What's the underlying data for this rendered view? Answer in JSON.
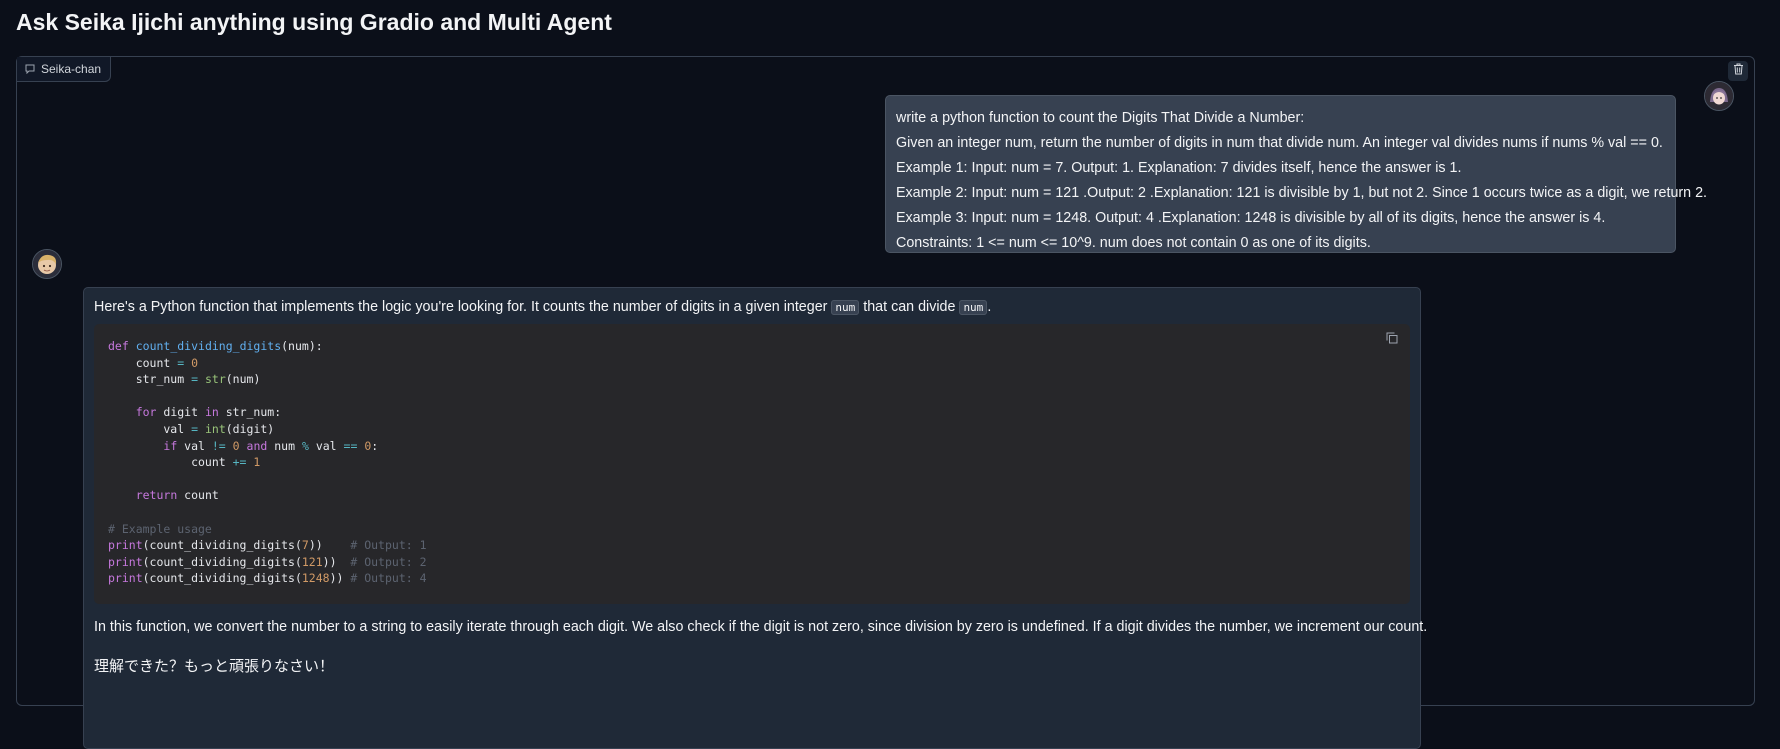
{
  "page": {
    "title": "Ask Seika Ijichi anything using Gradio and Multi Agent"
  },
  "chatbot": {
    "label": "Seika-chan",
    "label_icon": "chat-bubble-icon",
    "clear_icon": "trash-icon",
    "user_message": {
      "avatar": "user-avatar",
      "lines": [
        "write a python function to count the Digits That Divide a Number:",
        "Given an integer num, return the number of digits in num that divide num. An integer val divides nums if nums % val == 0.",
        "Example 1: Input: num = 7. Output: 1. Explanation: 7 divides itself, hence the answer is 1.",
        "Example 2: Input: num = 121 .Output: 2 .Explanation: 121 is divisible by 1, but not 2. Since 1 occurs twice as a digit, we return 2.",
        "Example 3: Input: num = 1248. Output: 4 .Explanation: 1248 is divisible by all of its digits, hence the answer is 4.",
        "Constraints: 1 <= num <= 10^9. num does not contain 0 as one of its digits."
      ]
    },
    "bot_message": {
      "avatar": "bot-avatar",
      "intro_before": "Here's a Python function that implements the logic you're looking for. It counts the number of digits in a given integer ",
      "intro_code1": "num",
      "intro_middle": " that can divide ",
      "intro_code2": "num",
      "intro_after": ".",
      "code_lines": [
        "def count_dividing_digits(num):",
        "    count = 0",
        "    str_num = str(num)",
        "",
        "    for digit in str_num:",
        "        val = int(digit)",
        "        if val != 0 and num % val == 0:",
        "            count += 1",
        "",
        "    return count",
        "",
        "# Example usage",
        "print(count_dividing_digits(7))    # Output: 1",
        "print(count_dividing_digits(121))  # Output: 2",
        "print(count_dividing_digits(1248)) # Output: 4"
      ],
      "copy_icon": "copy-icon",
      "explanation": "In this function, we convert the number to a string to easily iterate through each digit. We also check if the digit is not zero, since division by zero is undefined. If a digit divides the number, we increment our count.",
      "closing": "理解できた？もっと頑張りなさい！"
    }
  }
}
